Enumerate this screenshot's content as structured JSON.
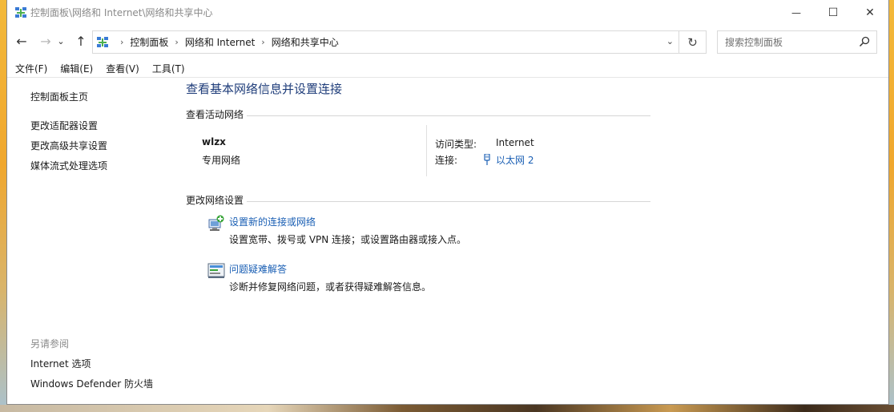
{
  "window": {
    "title": "控制面板\\网络和 Internet\\网络和共享中心",
    "minimize": "—",
    "maximize": "☐",
    "close": "✕"
  },
  "nav": {
    "back": "←",
    "forward": "→",
    "recent": "⌄",
    "up": "↑",
    "breadcrumb": [
      "控制面板",
      "网络和 Internet",
      "网络和共享中心"
    ],
    "separator": "›",
    "dropdown": "⌄",
    "refresh": "↻",
    "search_placeholder": "搜索控制面板"
  },
  "menu": [
    "文件(F)",
    "编辑(E)",
    "查看(V)",
    "工具(T)"
  ],
  "sidebar": {
    "home": "控制面板主页",
    "links": [
      "更改适配器设置",
      "更改高级共享设置",
      "媒体流式处理选项"
    ],
    "see_also_title": "另请参阅",
    "see_also": [
      "Internet 选项",
      "Windows Defender 防火墙"
    ]
  },
  "main": {
    "title": "查看基本网络信息并设置连接",
    "active_title": "查看活动网络",
    "network_name": "wlzx",
    "network_type": "专用网络",
    "access_label": "访问类型:",
    "access_value": "Internet",
    "conn_label": "连接:",
    "conn_value": "以太网 2",
    "change_title": "更改网络设置",
    "tasks": [
      {
        "icon": "network-setup-icon",
        "link": "设置新的连接或网络",
        "desc": "设置宽带、拨号或 VPN 连接；或设置路由器或接入点。"
      },
      {
        "icon": "troubleshoot-icon",
        "link": "问题疑难解答",
        "desc": "诊断并修复网络问题，或者获得疑难解答信息。"
      }
    ]
  },
  "colors": {
    "link": "#1a5fb4",
    "title": "#1f3d7a"
  }
}
